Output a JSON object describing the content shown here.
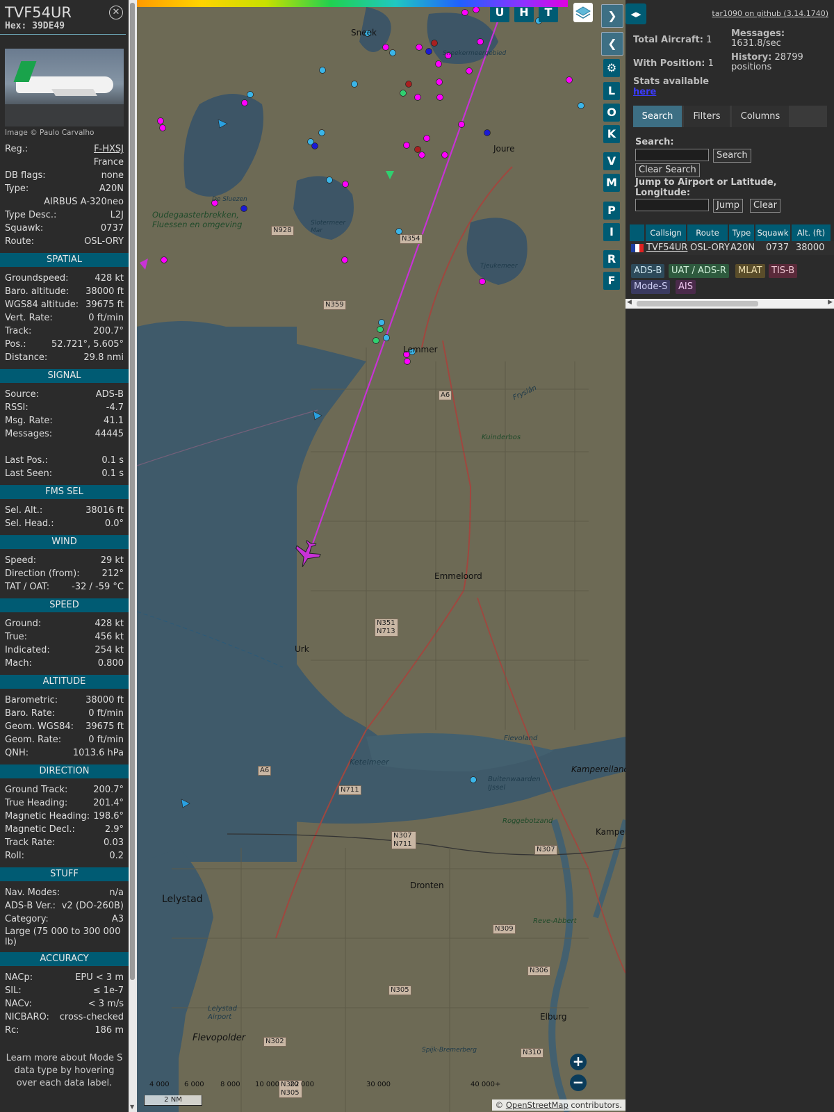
{
  "aircraft": {
    "callsign": "TVF54UR",
    "hex_label": "Hex:",
    "hex": "39DE49",
    "image_credit": "Image © Paulo Carvalho",
    "basic": [
      {
        "k": "Reg.:",
        "v": "F-HXSJ",
        "link": true
      },
      {
        "k": "",
        "v": "France"
      },
      {
        "k": "DB flags:",
        "v": "none"
      },
      {
        "k": "Type:",
        "v": "A20N"
      },
      {
        "k": "",
        "v": "AIRBUS A-320neo"
      },
      {
        "k": "Type Desc.:",
        "v": "L2J"
      },
      {
        "k": "Squawk:",
        "v": "0737"
      },
      {
        "k": "Route:",
        "v": "OSL-ORY"
      }
    ],
    "sections": [
      {
        "title": "SPATIAL",
        "rows": [
          {
            "k": "Groundspeed:",
            "v": "428 kt"
          },
          {
            "k": "Baro. altitude:",
            "v": "38000 ft"
          },
          {
            "k": "WGS84 altitude:",
            "v": "39675 ft"
          },
          {
            "k": "Vert. Rate:",
            "v": "0 ft/min"
          },
          {
            "k": "Track:",
            "v": "200.7°"
          },
          {
            "k": "Pos.:",
            "v": "52.721°, 5.605°"
          },
          {
            "k": "Distance:",
            "v": "29.8 nmi"
          }
        ]
      },
      {
        "title": "SIGNAL",
        "rows": [
          {
            "k": "Source:",
            "v": "ADS-B"
          },
          {
            "k": "RSSI:",
            "v": "-4.7"
          },
          {
            "k": "Msg. Rate:",
            "v": "41.1"
          },
          {
            "k": "Messages:",
            "v": "44445"
          },
          {
            "k": "",
            "v": ""
          },
          {
            "k": "Last Pos.:",
            "v": "0.1 s"
          },
          {
            "k": "Last Seen:",
            "v": "0.1 s"
          }
        ]
      },
      {
        "title": "FMS SEL",
        "rows": [
          {
            "k": "Sel. Alt.:",
            "v": "38016 ft"
          },
          {
            "k": "Sel. Head.:",
            "v": "0.0°"
          }
        ]
      },
      {
        "title": "WIND",
        "rows": [
          {
            "k": "Speed:",
            "v": "29 kt"
          },
          {
            "k": "Direction (from):",
            "v": "212°"
          },
          {
            "k": "TAT / OAT:",
            "v": "-32 / -59 °C"
          }
        ]
      },
      {
        "title": "SPEED",
        "rows": [
          {
            "k": "Ground:",
            "v": "428 kt"
          },
          {
            "k": "True:",
            "v": "456 kt"
          },
          {
            "k": "Indicated:",
            "v": "254 kt"
          },
          {
            "k": "Mach:",
            "v": "0.800"
          }
        ]
      },
      {
        "title": "ALTITUDE",
        "rows": [
          {
            "k": "Barometric:",
            "v": "38000 ft"
          },
          {
            "k": "Baro. Rate:",
            "v": "0 ft/min"
          },
          {
            "k": "Geom. WGS84:",
            "v": "39675 ft"
          },
          {
            "k": "Geom. Rate:",
            "v": "0 ft/min"
          },
          {
            "k": "QNH:",
            "v": "1013.6 hPa"
          }
        ]
      },
      {
        "title": "DIRECTION",
        "rows": [
          {
            "k": "Ground Track:",
            "v": "200.7°"
          },
          {
            "k": "True Heading:",
            "v": "201.4°"
          },
          {
            "k": "Magnetic Heading:",
            "v": "198.6°"
          },
          {
            "k": "Magnetic Decl.:",
            "v": "2.9°"
          },
          {
            "k": "Track Rate:",
            "v": "0.03"
          },
          {
            "k": "Roll:",
            "v": "0.2"
          }
        ]
      },
      {
        "title": "STUFF",
        "rows": [
          {
            "k": "Nav. Modes:",
            "v": "n/a"
          },
          {
            "k": "ADS-B Ver.:",
            "v": "v2 (DO-260B)"
          },
          {
            "k": "Category:",
            "v": "A3"
          }
        ],
        "note": "Large (75 000 to 300 000 lb)"
      },
      {
        "title": "ACCURACY",
        "rows": [
          {
            "k": "NACp:",
            "v": "EPU < 3 m"
          },
          {
            "k": "SIL:",
            "v": "≤ 1e-7"
          },
          {
            "k": "NACv:",
            "v": "< 3 m/s"
          },
          {
            "k": "NICBARO:",
            "v": "cross-checked"
          },
          {
            "k": "Rc:",
            "v": "186 m"
          }
        ]
      }
    ],
    "learn_more": "Learn more about Mode S data type by hovering over each data label."
  },
  "map": {
    "buttons_top": [
      "U",
      "H",
      "T"
    ],
    "side_buttons": [
      "L",
      "O",
      "K",
      "V",
      "M",
      "P",
      "I",
      "R",
      "F"
    ],
    "towns": [
      {
        "name": "Sneek"
      },
      {
        "name": "Joure"
      },
      {
        "name": "Lemmer"
      },
      {
        "name": "Emmeloord"
      },
      {
        "name": "Urk"
      },
      {
        "name": "Lelystad"
      },
      {
        "name": "Dronten"
      },
      {
        "name": "Kampereiland"
      },
      {
        "name": "Kampen"
      },
      {
        "name": "Elburg"
      },
      {
        "name": "Flevopolder"
      }
    ],
    "water_labels": [
      "Oudegaasterbrekken, Fluessen en omgeving",
      "De Sluezen",
      "Slotermeer Mar",
      "Tjeukemeer",
      "Ketelmeer",
      "Kuinderbos",
      "Flevoland",
      "Roggebotzand",
      "Reve-Abbert",
      "Lelystad Airport",
      "Fryslân",
      "Sneekermeergebied",
      "Spijk-Bremerberg",
      "Buitenwaarden IJssel"
    ],
    "roads": [
      "N928",
      "N354",
      "N359",
      "A6",
      "N351 N713",
      "A6",
      "N711",
      "N307 N711",
      "N307",
      "N309",
      "N306",
      "N305",
      "N302",
      "N310",
      "N302 N305"
    ],
    "colorbar_labels": [
      "4 000",
      "6 000",
      "8 000",
      "10 000",
      "20 000",
      "30 000",
      "40 000+"
    ],
    "scale": "2 NM",
    "attribution_prefix": "©",
    "attribution_link": "OpenStreetMap",
    "attribution_suffix": "contributors."
  },
  "panel": {
    "toggle": "◂▸",
    "github": "tar1090 on github (3.14.1740)",
    "total_aircraft_label": "Total Aircraft:",
    "total_aircraft": "1",
    "with_position_label": "With Position:",
    "with_position": "1",
    "stats_label": "Stats available",
    "stats_link": "here",
    "messages_label": "Messages:",
    "messages_value": "1631.8/sec",
    "history_label": "History:",
    "history_value": "28799 positions",
    "tabs": [
      "Search",
      "Filters",
      "Columns"
    ],
    "search_label": "Search:",
    "search_button": "Search",
    "clear_search_button": "Clear Search",
    "jump_label": "Jump to Airport or Latitude, Longitude:",
    "jump_button": "Jump",
    "clear_button": "Clear",
    "table_headers": [
      "Callsign",
      "Route",
      "Type",
      "Squawk",
      "Alt. (ft)"
    ],
    "table_row": {
      "callsign": "TVF54UR",
      "route": "OSL-ORY",
      "type": "A20N",
      "squawk": "0737",
      "alt": "38000"
    },
    "source_badges": [
      {
        "label": "ADS-B",
        "bg": "#2d4a5a",
        "fg": "#cfe6f0"
      },
      {
        "label": "UAT / ADS-R",
        "bg": "#2e5a3e",
        "fg": "#cfeed8"
      },
      {
        "label": "MLAT",
        "bg": "#5a4d2a",
        "fg": "#eedfb0"
      },
      {
        "label": "TIS-B",
        "bg": "#5a2a3a",
        "fg": "#f0c8d4"
      },
      {
        "label": "Mode-S",
        "bg": "#3a3a60",
        "fg": "#d0d0f4"
      },
      {
        "label": "AIS",
        "bg": "#4a2a4a",
        "fg": "#f0c8f0"
      }
    ]
  }
}
